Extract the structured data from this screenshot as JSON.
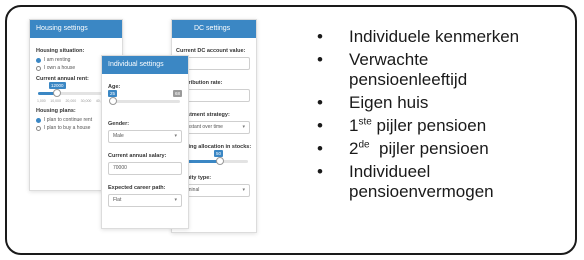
{
  "housing": {
    "title": "Housing settings",
    "situation_label": "Housing situation:",
    "options": [
      "I am renting",
      "I own a house"
    ],
    "rent_label": "Current annual rent:",
    "rent_value": "12000",
    "rent_ticks": [
      "1,000",
      "10,000",
      "20,000",
      "30,000",
      "40,000",
      "50"
    ],
    "plans_label": "Housing plans:",
    "plans": [
      "I plan to continue rent",
      "I plan to buy a house"
    ]
  },
  "dc": {
    "title": "DC settings",
    "account_label": "Current DC account value:",
    "contribution_label": "Contribution rate:",
    "strategy_label": "Investment strategy:",
    "strategy_value": "Constant over time",
    "allocation_label": "Starting allocation in stocks:",
    "allocation_value": "50",
    "type_label": "Annuity type:",
    "type_value": "Nominal"
  },
  "individual": {
    "title": "Individual settings",
    "age_label": "Age:",
    "age_value": "25",
    "age_max": "68",
    "gender_label": "Gender:",
    "gender_value": "Male",
    "salary_label": "Current annual salary:",
    "salary_value": "70000",
    "career_label": "Expected career path:",
    "career_value": "Flat"
  },
  "bullets": {
    "b1": "Individuele kenmerken",
    "b2": "Verwachte",
    "b2b": "pensioenleeftijd",
    "b3": "Eigen huis",
    "b4_pre": "1",
    "b4_sup": "ste",
    "b4_post": " pijler pensioen",
    "b5_pre": "2",
    "b5_sup": "de",
    "b5_post": "  pijler pensioen",
    "b6": "Individueel",
    "b6b": "pensioenvermogen",
    "marker": "•"
  },
  "colors": {
    "accent": "#3b87c4"
  }
}
